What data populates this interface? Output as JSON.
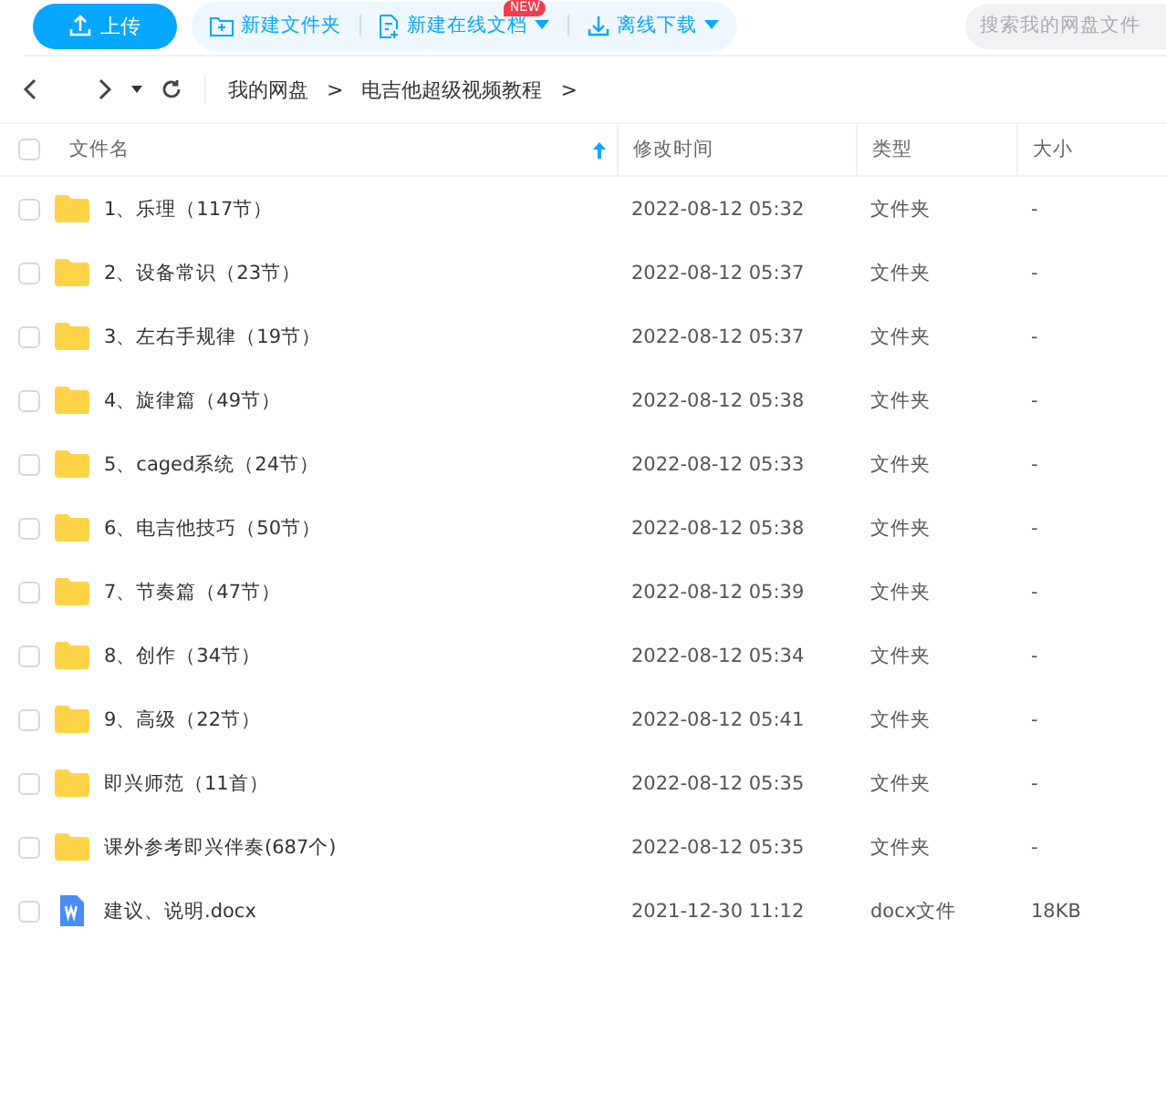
{
  "toolbar": {
    "upload": "上传",
    "new_folder": "新建文件夹",
    "new_doc": "新建在线文档",
    "new_badge": "NEW",
    "offline_download": "离线下载",
    "search": {
      "placeholder": "搜索我的网盘文件"
    }
  },
  "breadcrumb": [
    "我的网盘",
    "电吉他超级视频教程"
  ],
  "separator": ">",
  "table": {
    "select_all_checked": false,
    "columns": [
      {
        "label": "文件名",
        "sorted": true
      },
      {
        "label": "修改时间",
        "sorted": false
      },
      {
        "label": "类型",
        "sorted": false
      },
      {
        "label": "大小",
        "sorted": false
      }
    ],
    "rows": [
      {
        "kind": "folder",
        "name": "1、乐理（117节）",
        "modified": "2022-08-12 05:32",
        "type": "文件夹",
        "size": "-",
        "checked": false
      },
      {
        "kind": "folder",
        "name": "2、设备常识（23节）",
        "modified": "2022-08-12 05:37",
        "type": "文件夹",
        "size": "-",
        "checked": false
      },
      {
        "kind": "folder",
        "name": "3、左右手规律（19节）",
        "modified": "2022-08-12 05:37",
        "type": "文件夹",
        "size": "-",
        "checked": false
      },
      {
        "kind": "folder",
        "name": "4、旋律篇（49节）",
        "modified": "2022-08-12 05:38",
        "type": "文件夹",
        "size": "-",
        "checked": false
      },
      {
        "kind": "folder",
        "name": "5、caged系统（24节）",
        "modified": "2022-08-12 05:33",
        "type": "文件夹",
        "size": "-",
        "checked": false
      },
      {
        "kind": "folder",
        "name": "6、电吉他技巧（50节）",
        "modified": "2022-08-12 05:38",
        "type": "文件夹",
        "size": "-",
        "checked": false
      },
      {
        "kind": "folder",
        "name": "7、节奏篇（47节）",
        "modified": "2022-08-12 05:39",
        "type": "文件夹",
        "size": "-",
        "checked": false
      },
      {
        "kind": "folder",
        "name": "8、创作（34节）",
        "modified": "2022-08-12 05:34",
        "type": "文件夹",
        "size": "-",
        "checked": false
      },
      {
        "kind": "folder",
        "name": "9、高级（22节）",
        "modified": "2022-08-12 05:41",
        "type": "文件夹",
        "size": "-",
        "checked": false
      },
      {
        "kind": "folder",
        "name": "即兴师范（11首）",
        "modified": "2022-08-12 05:35",
        "type": "文件夹",
        "size": "-",
        "checked": false
      },
      {
        "kind": "folder",
        "name": "课外参考即兴伴奏(687个)",
        "modified": "2022-08-12 05:35",
        "type": "文件夹",
        "size": "-",
        "checked": false
      },
      {
        "kind": "doc",
        "name": "建议、说明.docx",
        "modified": "2021-12-30 11:12",
        "type": "docx文件",
        "size": "18KB",
        "checked": false
      }
    ]
  }
}
